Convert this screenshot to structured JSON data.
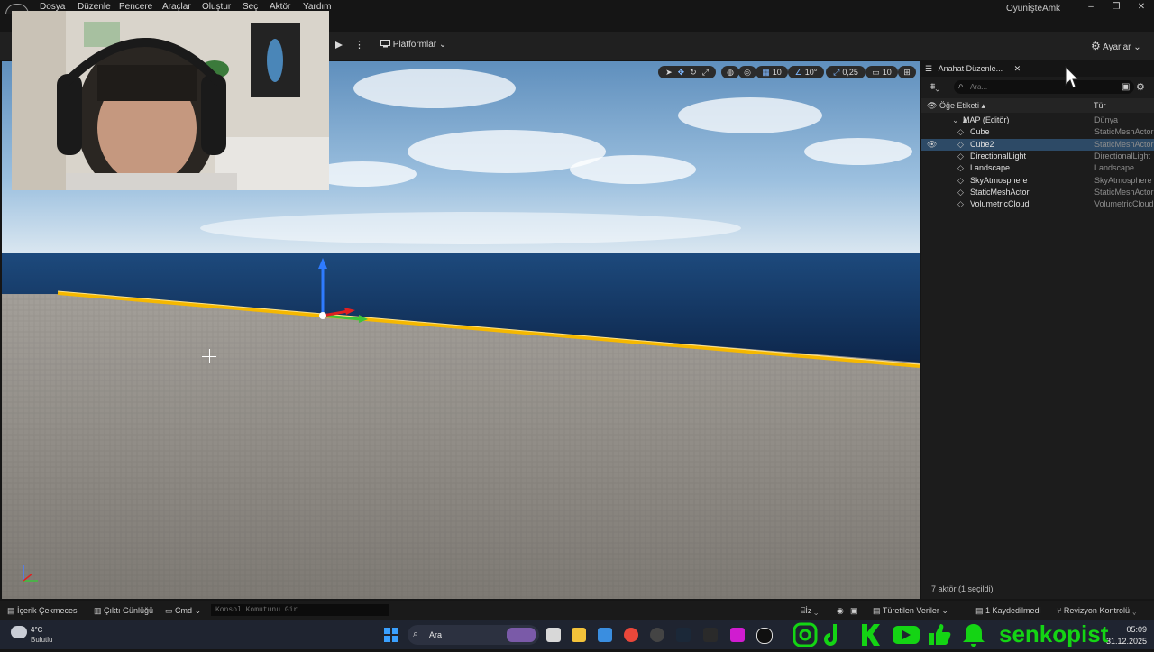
{
  "menu": [
    "Dosya",
    "Düzenle",
    "Pencere",
    "Araçlar",
    "Oluştur",
    "Seç",
    "Aktör",
    "Yardım"
  ],
  "app_title": "OyunİşteAmk",
  "window_controls": {
    "minimize": "–",
    "restore": "❐",
    "close": "✕"
  },
  "toolbar": {
    "platforms": "Platformlar",
    "settings": "Ayarlar"
  },
  "viewport_tools": {
    "grid": "10",
    "angle": "10°",
    "scale": "0,25",
    "camera": "10"
  },
  "outliner": {
    "tab": "Anahat Düzenle...",
    "search_placeholder": "Ara...",
    "col_label": "Öğe Etiketi",
    "col_type": "Tür",
    "rows": [
      {
        "name": "MAP (Editör)",
        "type": "Dünya",
        "indent": 1,
        "selected": false,
        "eye": false
      },
      {
        "name": "Cube",
        "type": "StaticMeshActor",
        "indent": 2,
        "selected": false,
        "eye": false
      },
      {
        "name": "Cube2",
        "type": "StaticMeshActor",
        "indent": 2,
        "selected": true,
        "eye": true
      },
      {
        "name": "DirectionalLight",
        "type": "DirectionalLight",
        "indent": 2,
        "selected": false,
        "eye": false
      },
      {
        "name": "Landscape",
        "type": "Landscape",
        "indent": 2,
        "selected": false,
        "eye": false
      },
      {
        "name": "SkyAtmosphere",
        "type": "SkyAtmosphere",
        "indent": 2,
        "selected": false,
        "eye": false
      },
      {
        "name": "StaticMeshActor",
        "type": "StaticMeshActor",
        "indent": 2,
        "selected": false,
        "eye": false
      },
      {
        "name": "VolumetricCloud",
        "type": "VolumetricCloud",
        "indent": 2,
        "selected": false,
        "eye": false
      }
    ],
    "actor_count": "7 aktör (1 seçildi)"
  },
  "bottom": {
    "content_drawer": "İçerik Çekmecesi",
    "output_log": "Çıktı Günlüğü",
    "cmd": "Cmd",
    "console_placeholder": "Konsol Komutunu Gir",
    "trace": "İz",
    "derived_data": "Türetilen Veriler",
    "unsaved": "1 Kaydedilmedi",
    "revision": "Revizyon Kontrolü"
  },
  "taskbar": {
    "temp": "4°C",
    "weather": "Bulutlu",
    "search": "Ara",
    "brand": "senkopist",
    "time": "05:09",
    "date": "31.12.2025"
  },
  "colors": {
    "accent": "#14d414",
    "selection": "#2d4a66",
    "highlight": "#f5b800"
  }
}
